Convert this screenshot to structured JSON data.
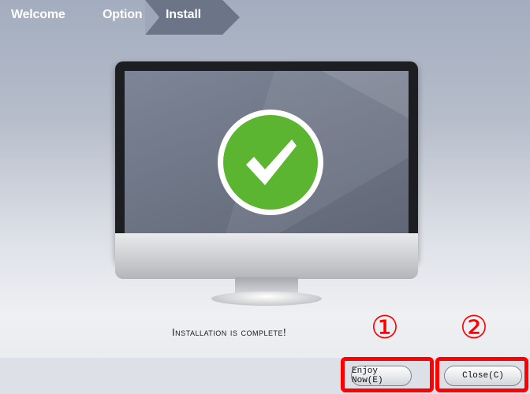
{
  "breadcrumb": {
    "steps": [
      "Welcome",
      "Option",
      "Install"
    ],
    "active_index": 2
  },
  "illustration": {
    "icon": "check-icon",
    "colors": {
      "check_green": "#5cb531",
      "screen": "#6c7383",
      "bezel": "#1c1e22"
    }
  },
  "status_text": "Installation is complete!",
  "buttons": {
    "enjoy_now": "Enjoy Now(E)",
    "close": "Close(C)"
  },
  "annotations": {
    "marker_1": "①",
    "marker_2": "②",
    "highlight_color": "#ff0000"
  }
}
